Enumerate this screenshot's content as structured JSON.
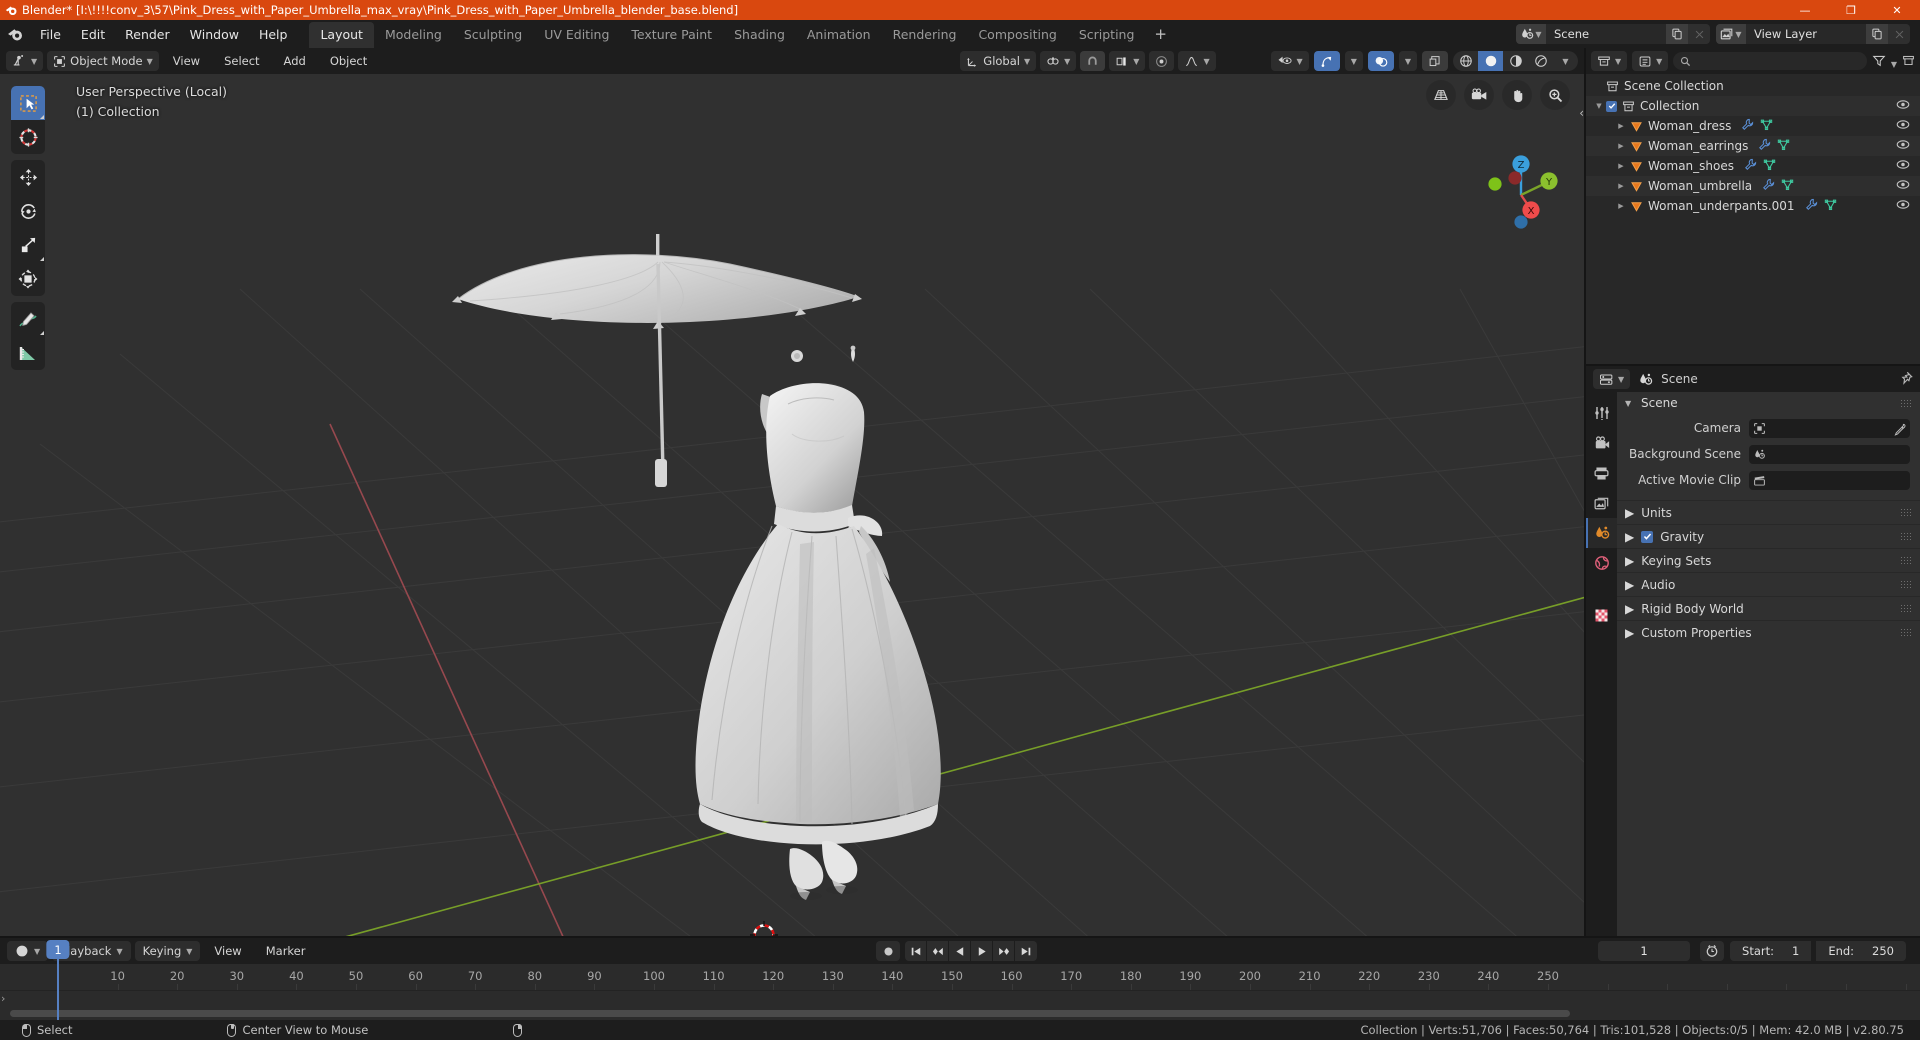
{
  "titlebar": {
    "app_icon": "blender-icon",
    "title": "Blender* [I:\\!!!!conv_3\\57\\Pink_Dress_with_Paper_Umbrella_max_vray\\Pink_Dress_with_Paper_Umbrella_blender_base.blend]",
    "accent_color": "#d9480f",
    "minimize": "—",
    "maximize": "❐",
    "close": "✕"
  },
  "topbar": {
    "menus": [
      "File",
      "Edit",
      "Render",
      "Window",
      "Help"
    ],
    "workspaces": [
      "Layout",
      "Modeling",
      "Sculpting",
      "UV Editing",
      "Texture Paint",
      "Shading",
      "Animation",
      "Rendering",
      "Compositing",
      "Scripting"
    ],
    "active_workspace": "Layout",
    "add_workspace": "+",
    "scene_name": "Scene",
    "view_layer_name": "View Layer"
  },
  "viewport": {
    "mode": "Object Mode",
    "menus": [
      "View",
      "Select",
      "Add",
      "Object"
    ],
    "transform_orientation": "Global",
    "overlay_line1": "User Perspective (Local)",
    "overlay_line2": "(1) Collection",
    "gizmo_axes": {
      "z": "Z",
      "y": "Y",
      "x": "X"
    },
    "nav_buttons": [
      "grid-toggle-icon",
      "camera-view-icon",
      "pan-view-icon",
      "zoom-view-icon"
    ],
    "toolbar_tools": [
      "select-box-tool-icon",
      "cursor-tool-icon",
      "move-tool-icon",
      "rotate-tool-icon",
      "scale-tool-icon",
      "transform-tool-icon",
      "annotate-tool-icon",
      "measure-tool-icon"
    ],
    "active_tool": "select-box-tool-icon",
    "background_color": "#303030",
    "grid_color": "#3a3a3a",
    "axis_x_color": "#9c4a50",
    "axis_y_color": "#7ba428"
  },
  "outliner": {
    "display_mode_icon": "outliner-icon",
    "filter_icon": "filter-icon",
    "search_placeholder": "",
    "root": "Scene Collection",
    "collection": "Collection",
    "items": [
      {
        "label": "Woman_dress",
        "icon": "mesh-triangle-icon",
        "modifier": true,
        "data": true
      },
      {
        "label": "Woman_earrings",
        "icon": "mesh-triangle-icon",
        "modifier": true,
        "data": true
      },
      {
        "label": "Woman_shoes",
        "icon": "mesh-triangle-icon",
        "modifier": true,
        "data": true
      },
      {
        "label": "Woman_umbrella",
        "icon": "mesh-triangle-icon",
        "modifier": true,
        "data": true
      },
      {
        "label": "Woman_underpants.001",
        "icon": "mesh-triangle-icon",
        "modifier": true,
        "data": true
      }
    ]
  },
  "properties": {
    "breadcrumb": "Scene",
    "tabs": [
      "tool-icon",
      "render-icon",
      "output-icon",
      "view-layer-icon",
      "scene-icon",
      "world-icon",
      "texture-icon"
    ],
    "active_tab": "scene-icon",
    "panel_title": "Scene",
    "fields": [
      {
        "label": "Camera",
        "value": "",
        "icon": "camera-data-icon",
        "eyedropper": true
      },
      {
        "label": "Background Scene",
        "value": "",
        "icon": "scene-data-icon",
        "eyedropper": false
      },
      {
        "label": "Active Movie Clip",
        "value": "",
        "icon": "clip-data-icon",
        "eyedropper": false
      }
    ],
    "sections": [
      {
        "label": "Units",
        "checkbox": false,
        "checked": false
      },
      {
        "label": "Gravity",
        "checkbox": true,
        "checked": true
      },
      {
        "label": "Keying Sets",
        "checkbox": false,
        "checked": false
      },
      {
        "label": "Audio",
        "checkbox": false,
        "checked": false
      },
      {
        "label": "Rigid Body World",
        "checkbox": false,
        "checked": false
      },
      {
        "label": "Custom Properties",
        "checkbox": false,
        "checked": false
      }
    ]
  },
  "timeline": {
    "editor_icon": "timeline-icon",
    "menus": [
      "Playback",
      "Keying",
      "View",
      "Marker"
    ],
    "playback_label": "Playback",
    "keying_label": "Keying",
    "view_label": "View",
    "marker_label": "Marker",
    "transport": [
      "jump-start-icon",
      "prev-keyframe-icon",
      "play-reverse-icon",
      "play-icon",
      "next-keyframe-icon",
      "jump-end-icon"
    ],
    "record_icon": "auto-keying-icon",
    "current_frame": "1",
    "start_label": "Start:",
    "start_value": "1",
    "end_label": "End:",
    "end_value": "250",
    "playhead_frame": "1",
    "ruler_ticks": [
      "10",
      "20",
      "30",
      "40",
      "50",
      "60",
      "70",
      "80",
      "90",
      "100",
      "110",
      "120",
      "130",
      "140",
      "150",
      "160",
      "170",
      "180",
      "190",
      "200",
      "210",
      "220",
      "230",
      "240",
      "250"
    ]
  },
  "statusbar": {
    "left_items": [
      {
        "icon": "mouse-left-icon",
        "label": "Select"
      },
      {
        "icon": "mouse-middle-icon",
        "label": "Center View to Mouse"
      },
      {
        "icon": "mouse-right-icon",
        "label": ""
      }
    ],
    "stats": "Collection | Verts:51,706 | Faces:50,764 | Tris:101,528 | Objects:0/5 | Mem: 42.0 MB | v2.80.75"
  }
}
